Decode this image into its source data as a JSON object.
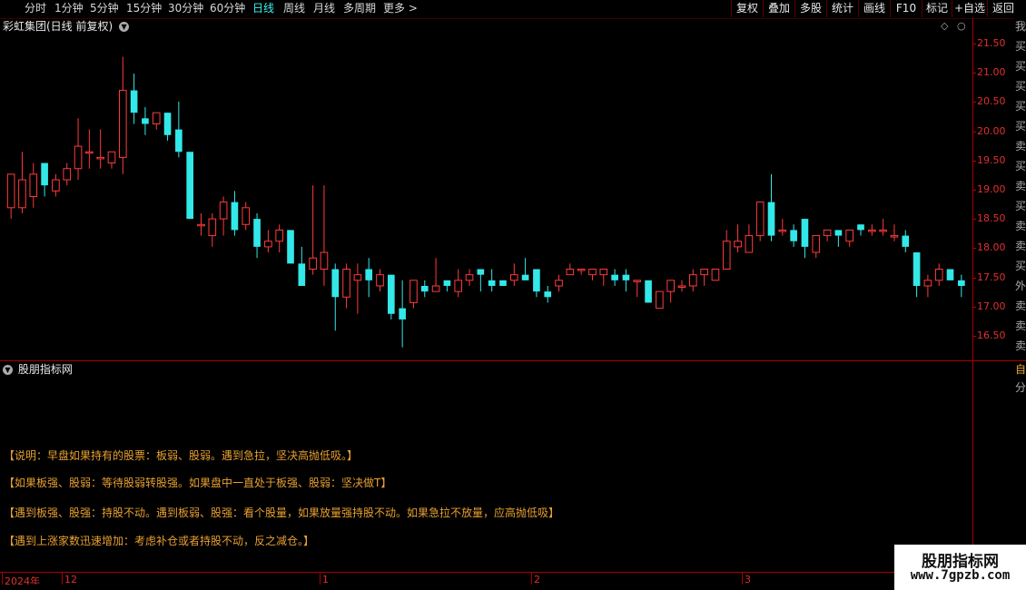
{
  "toolbar": {
    "periods": [
      "分时",
      "1分钟",
      "5分钟",
      "15分钟",
      "30分钟",
      "60分钟",
      "日线",
      "周线",
      "月线",
      "多周期",
      "更多 >"
    ],
    "active_period": "日线",
    "tools": [
      "复权",
      "叠加",
      "多股",
      "统计",
      "画线",
      "F10",
      "标记",
      "+自选",
      "返回"
    ]
  },
  "title": {
    "stock": "彩虹集团(日线 前复权)",
    "menu_icon": "chevron-down-icon"
  },
  "corner": {
    "diamond": "◇",
    "close": "○"
  },
  "price_axis": {
    "ticks": [
      "21.50",
      "21.00",
      "20.50",
      "20.00",
      "19.50",
      "19.00",
      "18.50",
      "18.00",
      "17.50",
      "17.00",
      "16.50"
    ]
  },
  "right_strip": [
    "我",
    "买",
    "买",
    "买",
    "买",
    "买",
    "卖",
    "买",
    "卖",
    "买",
    "卖",
    "卖",
    "买",
    "外",
    "卖",
    "卖",
    "卖"
  ],
  "sub_right": [
    "自",
    "分"
  ],
  "indicator": {
    "title": "股朋指标网",
    "notes": [
      "【说明：早盘如果持有的股票：板弱、股弱。遇到急拉，坚决高抛低吸。】",
      "【如果板强、股弱：等待股弱转股强。如果盘中一直处于板强、股弱：坚决做T】",
      "【遇到板强、股强：持股不动。遇到板弱、股强：看个股量，如果放量强持股不动。如果急拉不放量，应高抛低吸】",
      "【遇到上涨家数迅速增加：考虑补仓或者持股不动，反之减仓。】"
    ]
  },
  "time_axis": {
    "labels": [
      "2024年",
      "12",
      "1",
      "2",
      "3"
    ]
  },
  "watermark": {
    "line1": "股朋指标网",
    "line2": "www.7gpzb.com"
  },
  "colors": {
    "up": "#ff3b3b",
    "down": "#33e8e8",
    "axis": "#aa0000",
    "note": "#e8a030"
  },
  "chart_data": {
    "type": "candlestick",
    "ylim": [
      16.2,
      22.0
    ],
    "candles": [
      {
        "o": 18.9,
        "h": 19.5,
        "l": 18.7,
        "c": 19.5
      },
      {
        "o": 18.9,
        "h": 19.9,
        "l": 18.8,
        "c": 19.4
      },
      {
        "o": 19.1,
        "h": 19.7,
        "l": 18.9,
        "c": 19.5
      },
      {
        "o": 19.7,
        "h": 19.7,
        "l": 19.1,
        "c": 19.3
      },
      {
        "o": 19.2,
        "h": 19.5,
        "l": 19.1,
        "c": 19.4
      },
      {
        "o": 19.4,
        "h": 19.7,
        "l": 19.3,
        "c": 19.6
      },
      {
        "o": 19.6,
        "h": 20.5,
        "l": 19.4,
        "c": 20.0
      },
      {
        "o": 19.9,
        "h": 20.3,
        "l": 19.6,
        "c": 19.9
      },
      {
        "o": 19.8,
        "h": 20.3,
        "l": 19.6,
        "c": 19.8
      },
      {
        "o": 19.7,
        "h": 19.9,
        "l": 19.6,
        "c": 19.9
      },
      {
        "o": 19.8,
        "h": 21.6,
        "l": 19.5,
        "c": 21.0
      },
      {
        "o": 21.0,
        "h": 21.3,
        "l": 20.4,
        "c": 20.6
      },
      {
        "o": 20.5,
        "h": 20.7,
        "l": 20.2,
        "c": 20.4
      },
      {
        "o": 20.4,
        "h": 20.6,
        "l": 20.3,
        "c": 20.6
      },
      {
        "o": 20.6,
        "h": 20.6,
        "l": 20.1,
        "c": 20.2
      },
      {
        "o": 20.3,
        "h": 20.8,
        "l": 19.8,
        "c": 19.9
      },
      {
        "o": 19.9,
        "h": 19.9,
        "l": 18.7,
        "c": 18.7
      },
      {
        "o": 18.6,
        "h": 18.8,
        "l": 18.4,
        "c": 18.6
      },
      {
        "o": 18.4,
        "h": 18.8,
        "l": 18.2,
        "c": 18.7
      },
      {
        "o": 18.7,
        "h": 19.1,
        "l": 18.4,
        "c": 19.0
      },
      {
        "o": 19.0,
        "h": 19.2,
        "l": 18.4,
        "c": 18.5
      },
      {
        "o": 18.6,
        "h": 19.0,
        "l": 18.5,
        "c": 18.9
      },
      {
        "o": 18.7,
        "h": 18.8,
        "l": 18.0,
        "c": 18.2
      },
      {
        "o": 18.2,
        "h": 18.5,
        "l": 18.1,
        "c": 18.3
      },
      {
        "o": 18.3,
        "h": 18.6,
        "l": 18.1,
        "c": 18.5
      },
      {
        "o": 18.5,
        "h": 18.5,
        "l": 17.9,
        "c": 17.9
      },
      {
        "o": 17.9,
        "h": 18.2,
        "l": 17.5,
        "c": 17.5
      },
      {
        "o": 17.8,
        "h": 19.3,
        "l": 17.7,
        "c": 18.0
      },
      {
        "o": 17.8,
        "h": 19.3,
        "l": 17.5,
        "c": 18.1
      },
      {
        "o": 17.8,
        "h": 17.9,
        "l": 16.7,
        "c": 17.3
      },
      {
        "o": 17.3,
        "h": 17.9,
        "l": 17.1,
        "c": 17.8
      },
      {
        "o": 17.6,
        "h": 17.9,
        "l": 17.0,
        "c": 17.7
      },
      {
        "o": 17.8,
        "h": 18.0,
        "l": 17.3,
        "c": 17.6
      },
      {
        "o": 17.5,
        "h": 17.8,
        "l": 17.4,
        "c": 17.7
      },
      {
        "o": 17.7,
        "h": 17.7,
        "l": 16.9,
        "c": 17.0
      },
      {
        "o": 17.1,
        "h": 17.6,
        "l": 16.4,
        "c": 16.9
      },
      {
        "o": 17.2,
        "h": 17.6,
        "l": 17.1,
        "c": 17.6
      },
      {
        "o": 17.5,
        "h": 17.6,
        "l": 17.3,
        "c": 17.4
      },
      {
        "o": 17.4,
        "h": 18.0,
        "l": 17.4,
        "c": 17.5
      },
      {
        "o": 17.6,
        "h": 17.6,
        "l": 17.4,
        "c": 17.5
      },
      {
        "o": 17.4,
        "h": 17.8,
        "l": 17.3,
        "c": 17.6
      },
      {
        "o": 17.6,
        "h": 17.8,
        "l": 17.5,
        "c": 17.7
      },
      {
        "o": 17.8,
        "h": 17.8,
        "l": 17.4,
        "c": 17.7
      },
      {
        "o": 17.6,
        "h": 17.8,
        "l": 17.4,
        "c": 17.5
      },
      {
        "o": 17.6,
        "h": 17.6,
        "l": 17.5,
        "c": 17.5
      },
      {
        "o": 17.6,
        "h": 17.9,
        "l": 17.5,
        "c": 17.7
      },
      {
        "o": 17.7,
        "h": 18.0,
        "l": 17.6,
        "c": 17.6
      },
      {
        "o": 17.8,
        "h": 17.8,
        "l": 17.3,
        "c": 17.4
      },
      {
        "o": 17.4,
        "h": 17.5,
        "l": 17.2,
        "c": 17.3
      },
      {
        "o": 17.5,
        "h": 17.7,
        "l": 17.4,
        "c": 17.6
      },
      {
        "o": 17.7,
        "h": 17.9,
        "l": 17.7,
        "c": 17.8
      },
      {
        "o": 17.8,
        "h": 17.8,
        "l": 17.7,
        "c": 17.8
      },
      {
        "o": 17.7,
        "h": 17.8,
        "l": 17.6,
        "c": 17.8
      },
      {
        "o": 17.7,
        "h": 17.8,
        "l": 17.5,
        "c": 17.8
      },
      {
        "o": 17.7,
        "h": 17.8,
        "l": 17.5,
        "c": 17.6
      },
      {
        "o": 17.7,
        "h": 17.8,
        "l": 17.4,
        "c": 17.6
      },
      {
        "o": 17.6,
        "h": 17.6,
        "l": 17.3,
        "c": 17.6
      },
      {
        "o": 17.6,
        "h": 17.6,
        "l": 17.2,
        "c": 17.2
      },
      {
        "o": 17.1,
        "h": 17.4,
        "l": 17.1,
        "c": 17.4
      },
      {
        "o": 17.4,
        "h": 17.6,
        "l": 17.2,
        "c": 17.6
      },
      {
        "o": 17.5,
        "h": 17.6,
        "l": 17.4,
        "c": 17.5
      },
      {
        "o": 17.5,
        "h": 17.8,
        "l": 17.4,
        "c": 17.7
      },
      {
        "o": 17.7,
        "h": 17.7,
        "l": 17.5,
        "c": 17.8
      },
      {
        "o": 17.6,
        "h": 17.8,
        "l": 17.6,
        "c": 17.8
      },
      {
        "o": 17.8,
        "h": 18.5,
        "l": 17.8,
        "c": 18.3
      },
      {
        "o": 18.2,
        "h": 18.6,
        "l": 18.1,
        "c": 18.3
      },
      {
        "o": 18.1,
        "h": 18.6,
        "l": 18.1,
        "c": 18.4
      },
      {
        "o": 18.4,
        "h": 19.0,
        "l": 18.3,
        "c": 19.0
      },
      {
        "o": 19.0,
        "h": 19.5,
        "l": 18.3,
        "c": 18.4
      },
      {
        "o": 18.5,
        "h": 18.7,
        "l": 18.4,
        "c": 18.5
      },
      {
        "o": 18.5,
        "h": 18.6,
        "l": 18.2,
        "c": 18.3
      },
      {
        "o": 18.7,
        "h": 18.7,
        "l": 18.0,
        "c": 18.2
      },
      {
        "o": 18.1,
        "h": 18.4,
        "l": 18.0,
        "c": 18.4
      },
      {
        "o": 18.4,
        "h": 18.5,
        "l": 18.3,
        "c": 18.5
      },
      {
        "o": 18.5,
        "h": 18.5,
        "l": 18.2,
        "c": 18.4
      },
      {
        "o": 18.3,
        "h": 18.5,
        "l": 18.2,
        "c": 18.5
      },
      {
        "o": 18.6,
        "h": 18.6,
        "l": 18.4,
        "c": 18.5
      },
      {
        "o": 18.5,
        "h": 18.6,
        "l": 18.4,
        "c": 18.5
      },
      {
        "o": 18.5,
        "h": 18.7,
        "l": 18.4,
        "c": 18.5
      },
      {
        "o": 18.4,
        "h": 18.6,
        "l": 18.3,
        "c": 18.4
      },
      {
        "o": 18.4,
        "h": 18.5,
        "l": 18.1,
        "c": 18.2
      },
      {
        "o": 18.1,
        "h": 18.1,
        "l": 17.3,
        "c": 17.5
      },
      {
        "o": 17.5,
        "h": 17.7,
        "l": 17.3,
        "c": 17.6
      },
      {
        "o": 17.6,
        "h": 17.9,
        "l": 17.5,
        "c": 17.8
      },
      {
        "o": 17.8,
        "h": 17.8,
        "l": 17.6,
        "c": 17.6
      },
      {
        "o": 17.6,
        "h": 17.7,
        "l": 17.3,
        "c": 17.5
      }
    ]
  }
}
